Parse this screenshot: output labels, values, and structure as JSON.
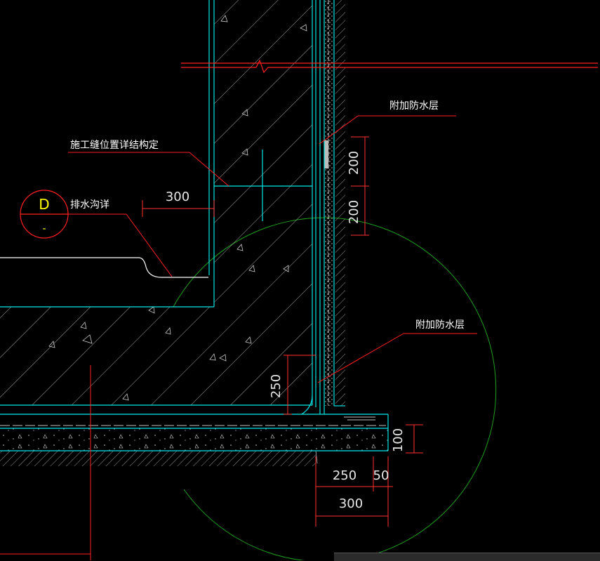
{
  "drawing": {
    "labels": {
      "waterproof_top": "附加防水层",
      "waterproof_bottom": "附加防水层",
      "construction_joint": "施工缝位置详结构定",
      "drain_ditch": "排水沟详"
    },
    "detail_mark": {
      "letter": "D",
      "sheet": "-"
    },
    "dimensions": {
      "ditch_width": "300",
      "upper_200_a": "200",
      "upper_200_b": "200",
      "fillet_250": "250",
      "slab_100": "100",
      "base_250": "250",
      "base_50": "50",
      "base_300": "300"
    },
    "colors": {
      "background": "#000000",
      "structure": "#00e5e5",
      "leader": "#ff2020",
      "dimension": "#ff3030",
      "circle": "#1f9f1f",
      "hatch": "#d0d0d0",
      "detail_text": "#ffff00"
    }
  }
}
